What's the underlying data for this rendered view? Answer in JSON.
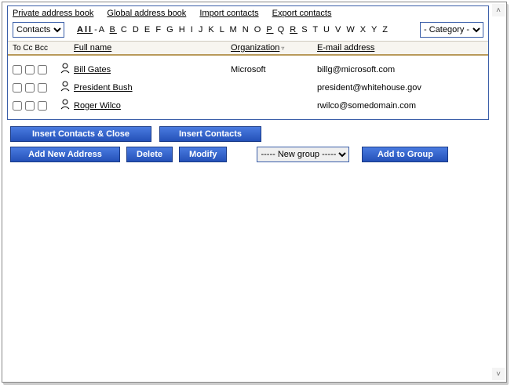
{
  "topLinks": {
    "private": "Private address book",
    "global": "Global address book",
    "import": "Import contacts",
    "export": "Export contacts"
  },
  "filter": {
    "contactsSelect": "Contacts",
    "allLabel": "All",
    "alphabet": "A B C D E F G H I J K L M N O P Q R S T U V W X Y Z",
    "categorySelect": "- Category -"
  },
  "headers": {
    "checks": "To Cc Bcc",
    "name": "Full name",
    "org": "Organization",
    "email": "E-mail address"
  },
  "contacts": [
    {
      "name": "Bill Gates",
      "org": "Microsoft",
      "email": "billg@microsoft.com"
    },
    {
      "name": "President Bush",
      "org": "",
      "email": "president@whitehouse.gov"
    },
    {
      "name": "Roger Wilco",
      "org": "",
      "email": "rwilco@somedomain.com"
    }
  ],
  "buttons": {
    "insertClose": "Insert Contacts & Close",
    "insert": "Insert Contacts",
    "addNew": "Add New Address",
    "delete": "Delete",
    "modify": "Modify",
    "addToGroup": "Add to Group"
  },
  "groupSelect": "----- New group -----"
}
